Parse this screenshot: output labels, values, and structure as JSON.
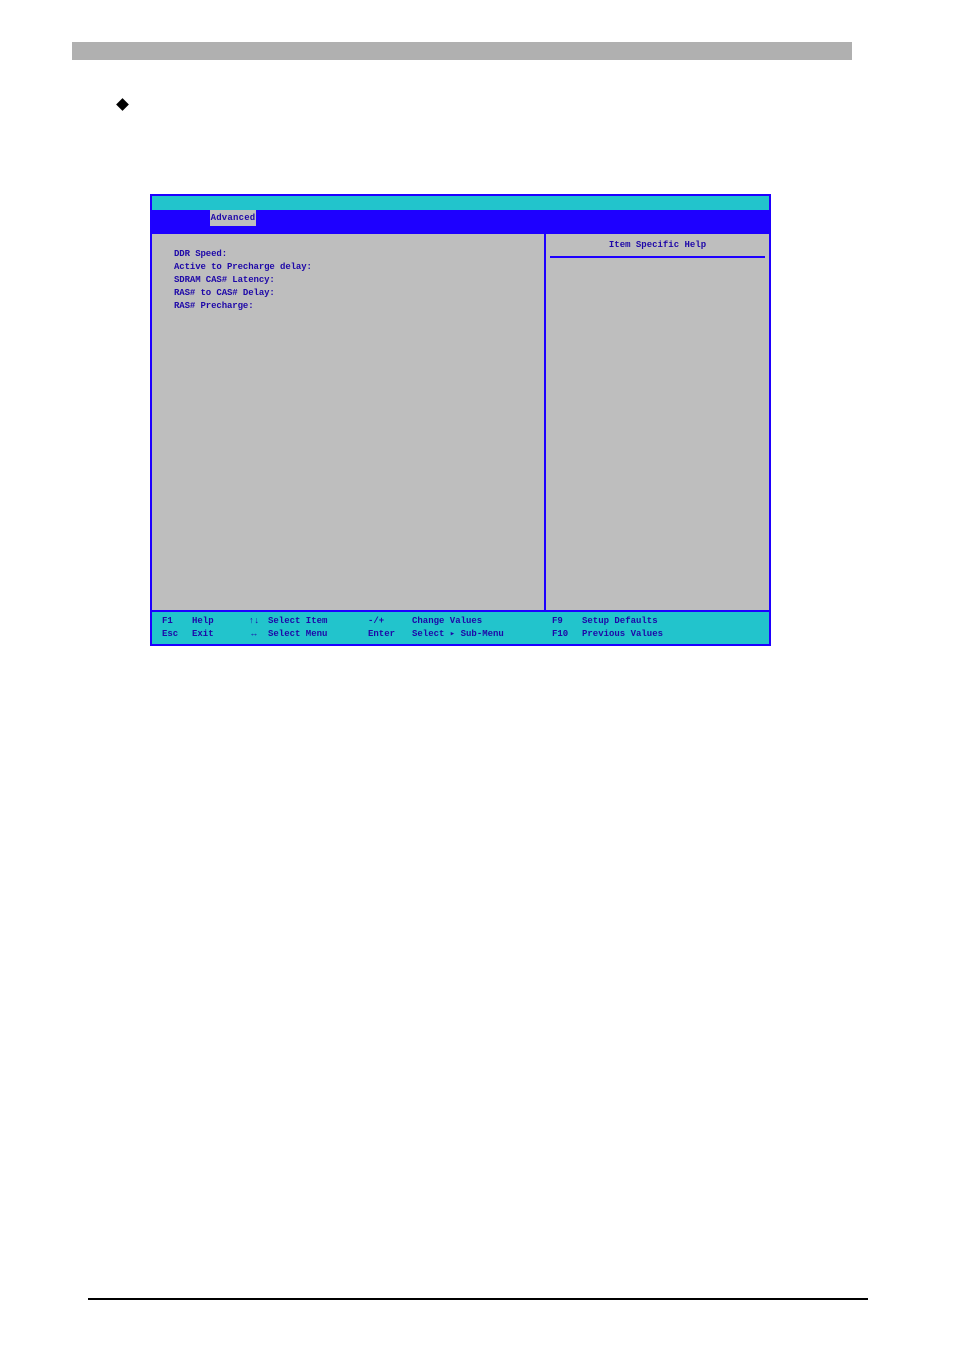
{
  "tabbar": {
    "advanced": "Advanced"
  },
  "main": {
    "row1": "DDR Speed:",
    "row2": "Active to Precharge delay:",
    "row3": "SDRAM CAS# Latency:",
    "row4": "RAS# to CAS# Delay:",
    "row5": "RAS# Precharge:"
  },
  "help": {
    "title": "Item Specific Help"
  },
  "footer": {
    "r1": {
      "k1": "F1",
      "l1": "Help",
      "i1": "↑↓",
      "a1": "Select Item",
      "k2": "-/+",
      "a2": "Change Values",
      "k3": "F9",
      "a3": "Setup Defaults"
    },
    "r2": {
      "k1": "Esc",
      "l1": "Exit",
      "i1": "↔",
      "a1": "Select Menu",
      "k2": "Enter",
      "a2": "Select ▸ Sub-Menu",
      "k3": "F10",
      "a3": "Previous Values"
    }
  }
}
